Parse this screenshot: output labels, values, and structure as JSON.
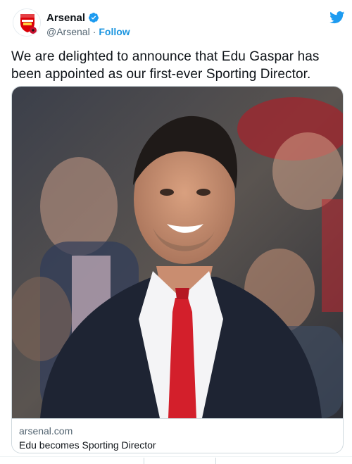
{
  "account": {
    "display_name": "Arsenal",
    "handle": "@Arsenal",
    "separator": "·",
    "follow_label": "Follow",
    "verified": true
  },
  "tweet": {
    "text": "We are delighted to announce that Edu Gaspar has been appointed as our first-ever Sporting Director."
  },
  "card": {
    "domain": "arsenal.com",
    "title": "Edu becomes Sporting Director"
  },
  "colors": {
    "accent": "#1b95e0",
    "text": "#0f1419",
    "muted": "#536471",
    "border": "#cfd9de"
  },
  "icons": {
    "verified": "verified-badge-icon",
    "platform": "twitter-bird-icon",
    "avatar": "arsenal-crest-icon"
  }
}
